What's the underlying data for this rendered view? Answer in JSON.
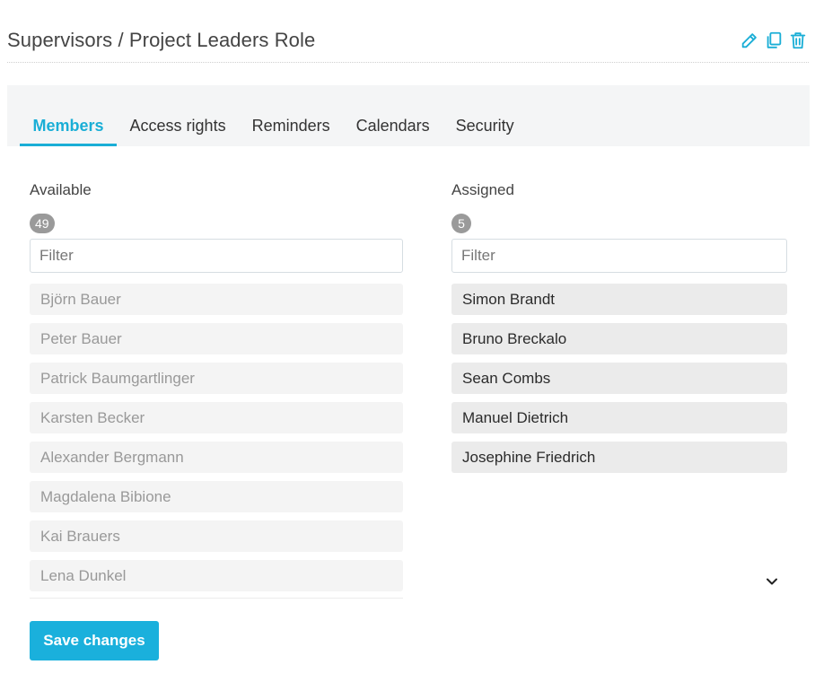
{
  "header": {
    "title": "Supervisors / Project Leaders Role",
    "actions": [
      {
        "name": "edit",
        "icon": "pencil-icon"
      },
      {
        "name": "duplicate",
        "icon": "copy-icon"
      },
      {
        "name": "delete",
        "icon": "trash-icon"
      }
    ]
  },
  "tabs": [
    {
      "label": "Members",
      "active": true
    },
    {
      "label": "Access rights",
      "active": false
    },
    {
      "label": "Reminders",
      "active": false
    },
    {
      "label": "Calendars",
      "active": false
    },
    {
      "label": "Security",
      "active": false
    }
  ],
  "available": {
    "label": "Available",
    "count": "49",
    "filter_placeholder": "Filter",
    "filter_value": "",
    "items": [
      "Björn Bauer",
      "Peter Bauer",
      "Patrick Baumgartlinger",
      "Karsten Becker",
      "Alexander Bergmann",
      "Magdalena Bibione",
      "Kai Brauers",
      "Lena Dunkel"
    ]
  },
  "assigned": {
    "label": "Assigned",
    "count": "5",
    "filter_placeholder": "Filter",
    "filter_value": "",
    "items": [
      "Simon Brandt",
      "Bruno Breckalo",
      "Sean Combs",
      "Manuel Dietrich",
      "Josephine Friedrich"
    ]
  },
  "footer": {
    "save_label": "Save changes"
  },
  "colors": {
    "accent": "#1aaed6",
    "badge": "#9a9a9a",
    "tabbar_bg": "#f4f5f6"
  }
}
